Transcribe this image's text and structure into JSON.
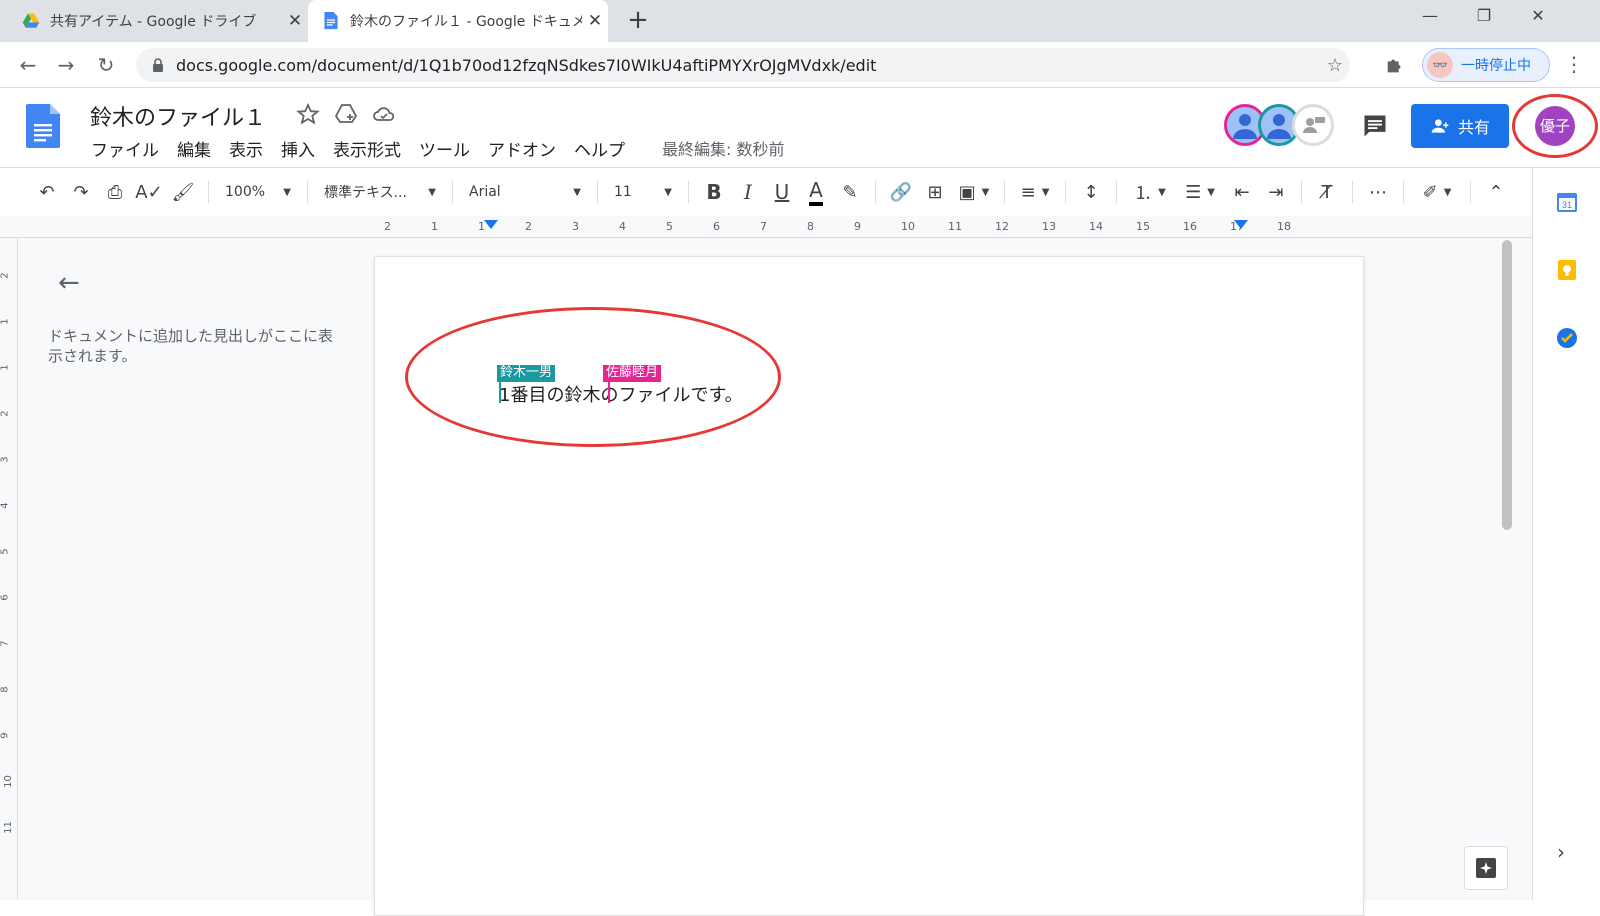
{
  "browser": {
    "tabs": [
      {
        "title": "共有アイテム - Google ドライブ",
        "active": false
      },
      {
        "title": "鈴木のファイル１ - Google ドキュメン",
        "active": true
      }
    ],
    "new_tab_label": "+",
    "window_controls": {
      "minimize": "—",
      "restore": "❐",
      "close": "✕"
    },
    "url": "docs.google.com/document/d/1Q1b70od12fzqNSdkes7I0WIkU4aftiPMYXrOJgMVdxk/edit",
    "profile_label": "一時停止中"
  },
  "docs": {
    "title": "鈴木のファイル１",
    "menu": [
      "ファイル",
      "編集",
      "表示",
      "挿入",
      "表示形式",
      "ツール",
      "アドオン",
      "ヘルプ"
    ],
    "last_edit": "最終編集: 数秒前",
    "share_label": "共有",
    "user_avatar": "優子",
    "collaborator_colors": [
      "#e52592",
      "#1a9aa0",
      "#9e9e9e"
    ]
  },
  "toolbar": {
    "zoom": "100%",
    "style": "標準テキス...",
    "font": "Arial",
    "size": "11"
  },
  "ruler": {
    "marks": [
      "2",
      "1",
      "1",
      "2",
      "3",
      "4",
      "5",
      "6",
      "7",
      "8",
      "9",
      "10",
      "11",
      "12",
      "13",
      "14",
      "15",
      "16",
      "17",
      "18"
    ],
    "vertical_marks": [
      "2",
      "1",
      "1",
      "2",
      "3",
      "4",
      "5",
      "6",
      "7",
      "8",
      "9",
      "10",
      "11"
    ]
  },
  "outline": {
    "hint": "ドキュメントに追加した見出しがここに表示されます。"
  },
  "document": {
    "text": "1番目の鈴木のファイルです。",
    "cursors": [
      {
        "name": "鈴木一男",
        "color": "#1a9aa0"
      },
      {
        "name": "佐藤睦月",
        "color": "#e52592"
      }
    ]
  },
  "colors": {
    "annotation": "#e53935",
    "accent": "#1a73e8"
  }
}
